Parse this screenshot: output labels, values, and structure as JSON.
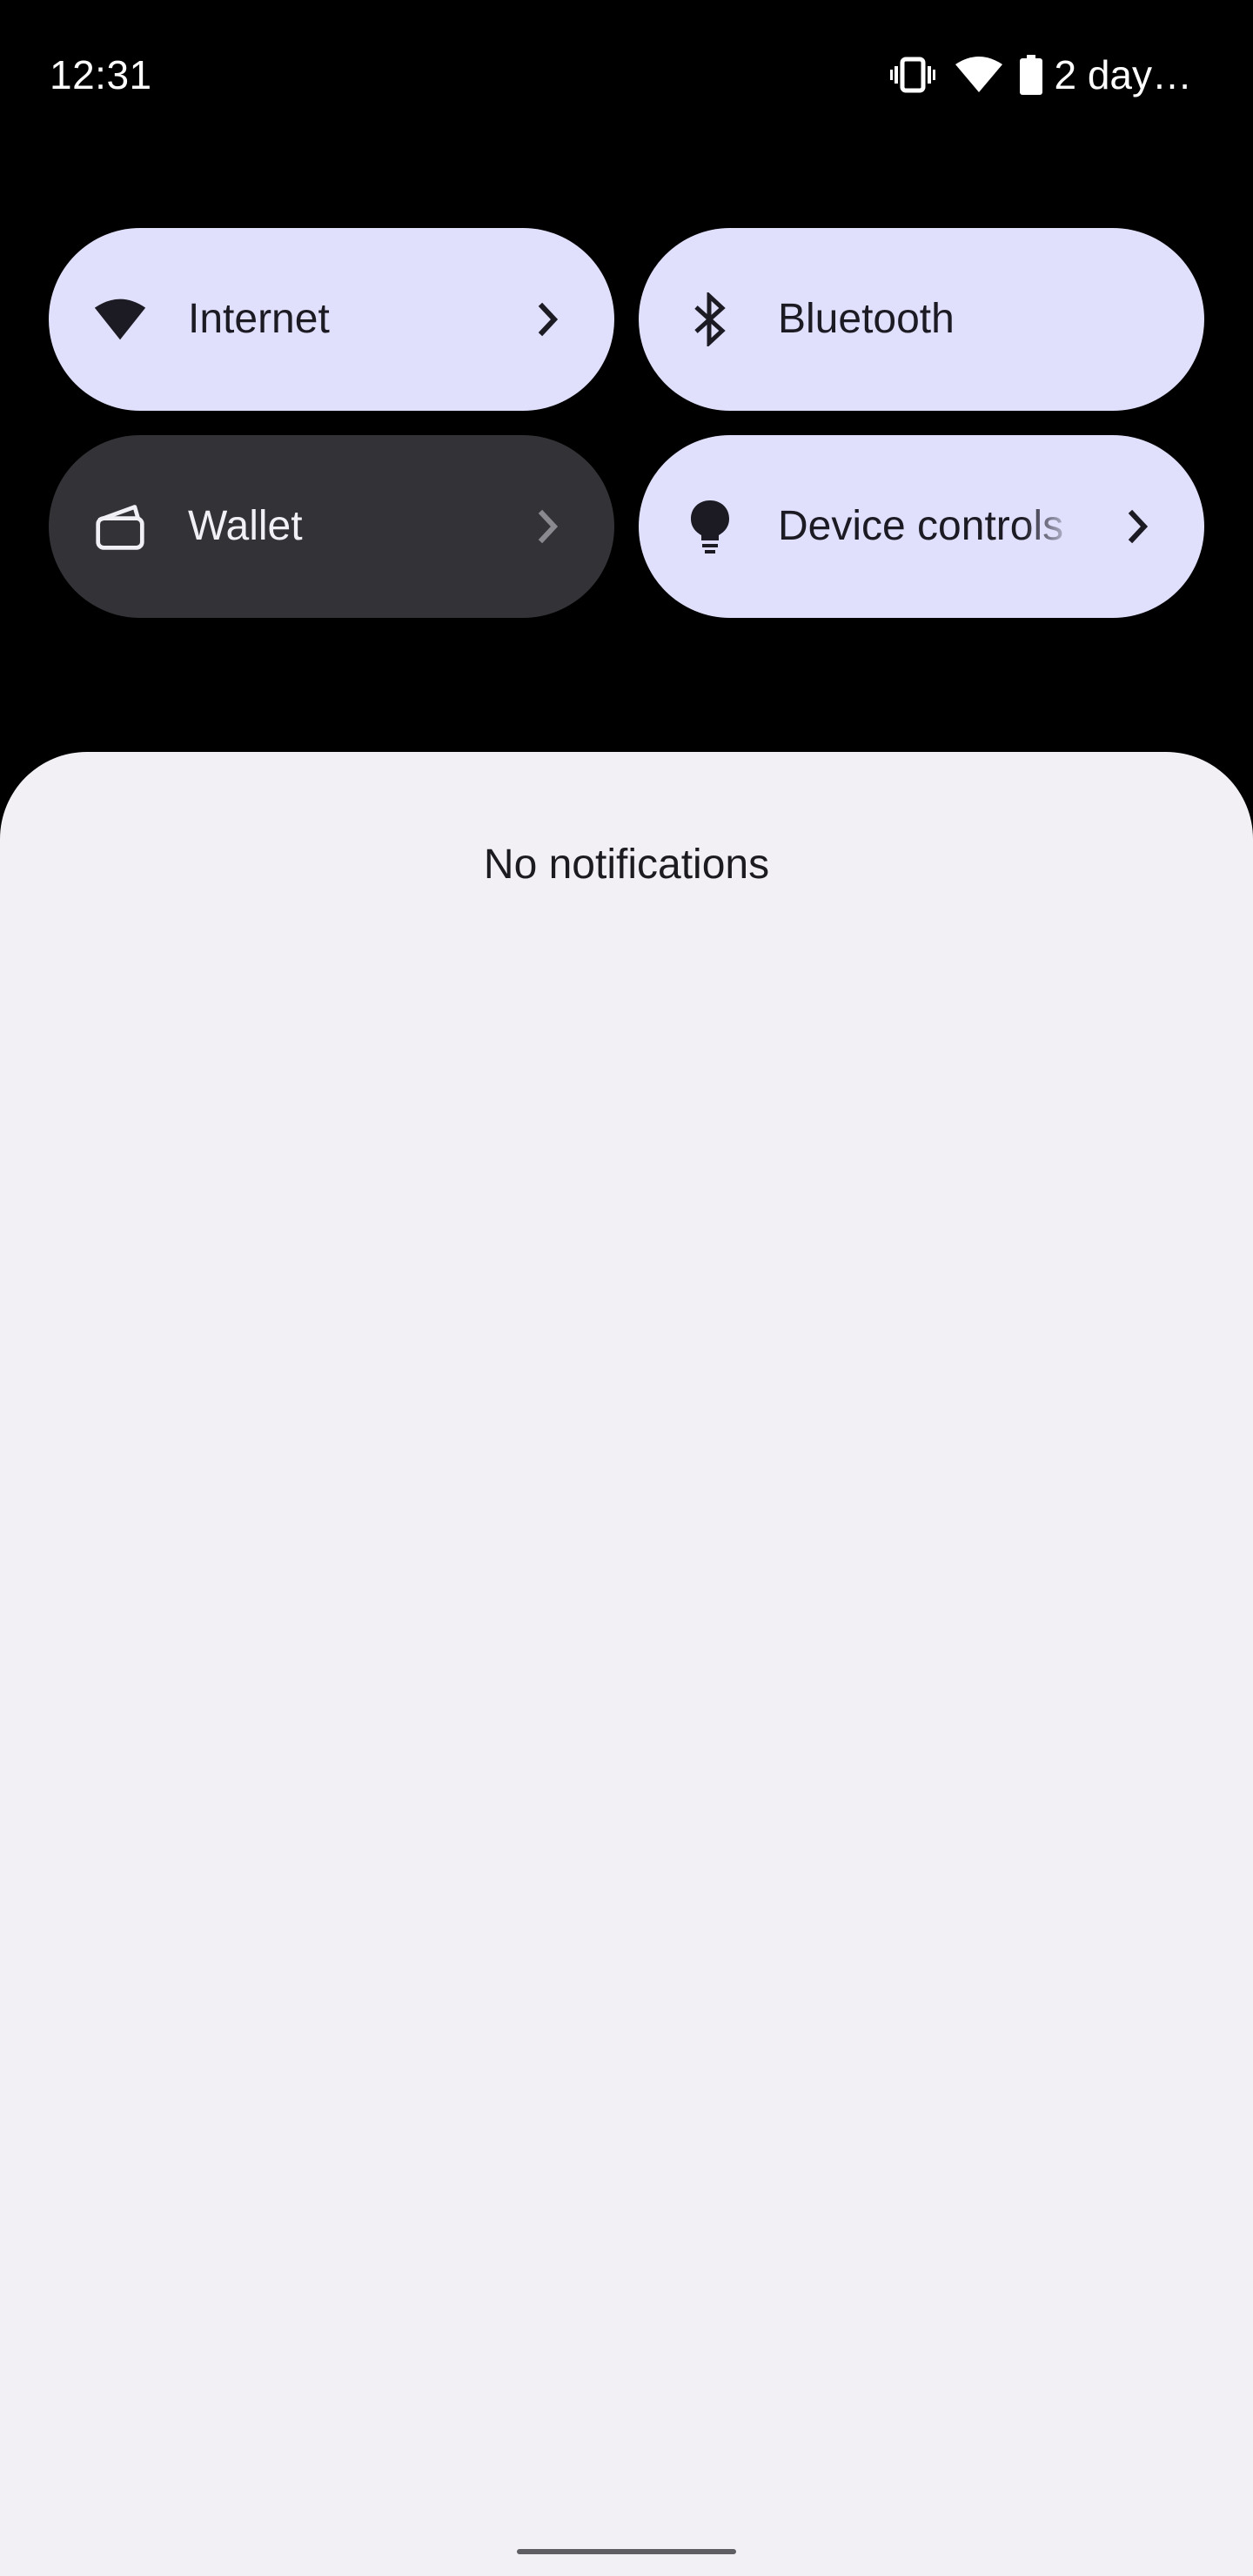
{
  "status_bar": {
    "time": "12:31",
    "battery_text": "2 day…",
    "icons": [
      "vibrate-icon",
      "wifi-icon",
      "battery-icon"
    ]
  },
  "quick_settings": {
    "tiles": [
      {
        "label": "Internet",
        "icon": "wifi-icon",
        "state": "on",
        "has_chevron": true
      },
      {
        "label": "Bluetooth",
        "icon": "bluetooth-icon",
        "state": "on",
        "has_chevron": false
      },
      {
        "label": "Wallet",
        "icon": "wallet-icon",
        "state": "off",
        "has_chevron": true
      },
      {
        "label": "Device controls",
        "icon": "lightbulb-icon",
        "state": "on",
        "has_chevron": true
      }
    ]
  },
  "notifications": {
    "empty_message": "No notifications"
  },
  "colors": {
    "background": "#000000",
    "tile_on": "#e0e0fd",
    "tile_off": "#333236",
    "panel": "#f2f0f4"
  }
}
